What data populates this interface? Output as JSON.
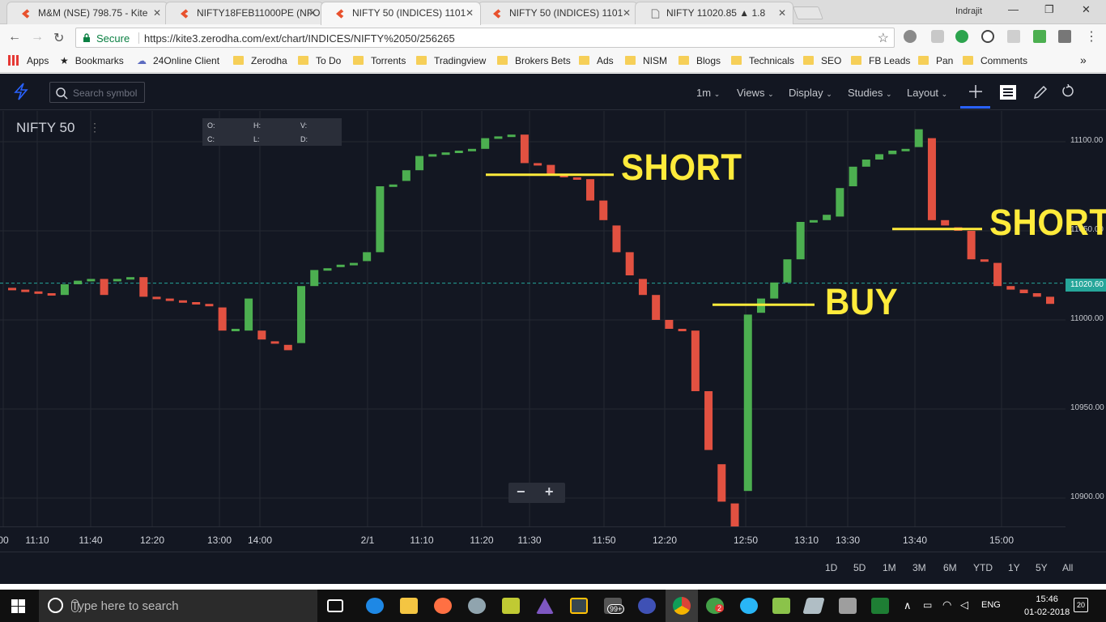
{
  "browser": {
    "tabs": [
      {
        "label": "M&M (NSE) 798.75 - Kite",
        "favicon": "kite-icon",
        "active": false
      },
      {
        "label": "NIFTY18FEB11000PE (NFO",
        "favicon": "kite-icon",
        "active": false
      },
      {
        "label": "NIFTY 50 (INDICES) 1101",
        "favicon": "kite-icon",
        "active": true
      },
      {
        "label": "NIFTY 50 (INDICES) 1101",
        "favicon": "kite-icon",
        "active": false
      },
      {
        "label": "NIFTY   11020.85  ▲ 1.8",
        "favicon": "page-icon",
        "active": false
      }
    ],
    "profile_name": "Indrajit",
    "secure_label": "Secure",
    "url": "https://kite3.zerodha.com/ext/chart/INDICES/NIFTY%2050/256265",
    "bookmarks": [
      {
        "label": "Apps",
        "icon": "apps-grid-icon"
      },
      {
        "label": "Bookmarks",
        "icon": "star-icon"
      },
      {
        "label": "24Online Client",
        "icon": "cloud-icon"
      },
      {
        "label": "Zerodha",
        "icon": "folder-icon"
      },
      {
        "label": "To Do",
        "icon": "folder-icon"
      },
      {
        "label": "Torrents",
        "icon": "folder-icon"
      },
      {
        "label": "Tradingview",
        "icon": "folder-icon"
      },
      {
        "label": "Brokers Bets",
        "icon": "folder-icon"
      },
      {
        "label": "Ads",
        "icon": "folder-icon"
      },
      {
        "label": "NISM",
        "icon": "folder-icon"
      },
      {
        "label": "Blogs",
        "icon": "folder-icon"
      },
      {
        "label": "Technicals",
        "icon": "folder-icon"
      },
      {
        "label": "SEO",
        "icon": "folder-icon"
      },
      {
        "label": "FB Leads",
        "icon": "folder-icon"
      },
      {
        "label": "Pan",
        "icon": "folder-icon"
      },
      {
        "label": "Comments",
        "icon": "folder-icon"
      }
    ],
    "overflow": "»"
  },
  "kite": {
    "search_placeholder": "Search symbol",
    "menus": [
      {
        "label": "1m"
      },
      {
        "label": "Views"
      },
      {
        "label": "Display"
      },
      {
        "label": "Studies"
      },
      {
        "label": "Layout"
      }
    ],
    "symbol": "NIFTY 50",
    "ohlc": {
      "o": "O:",
      "h": "H:",
      "v": "V:",
      "c": "C:",
      "l": "L:",
      "d": "D:"
    },
    "zoom_out": "−",
    "zoom_in": "+",
    "ranges": [
      "1D",
      "5D",
      "1M",
      "3M",
      "6M",
      "YTD",
      "1Y",
      "5Y",
      "All"
    ],
    "annotations": [
      {
        "text": "SHORT",
        "kind": "short"
      },
      {
        "text": "SHORT",
        "kind": "short"
      },
      {
        "text": "BUY",
        "kind": "buy"
      }
    ]
  },
  "chart_data": {
    "type": "candlestick",
    "symbol": "NIFTY 50",
    "interval": "1m",
    "last_price_label": "11020.60",
    "y_ticks": [
      "11100.00",
      "11050.00",
      "11000.00",
      "10950.00",
      "10900.00"
    ],
    "ylim": [
      10880,
      11120
    ],
    "x_ticks": [
      "00",
      "11:10",
      "11:40",
      "12:20",
      "13:00",
      "14:00",
      "2/1",
      "11:10",
      "11:20",
      "11:30",
      "11:50",
      "12:20",
      "12:50",
      "13:10",
      "13:30",
      "13:40",
      "15:00"
    ],
    "colors": {
      "up": "#4caf50",
      "down": "#e25141",
      "background": "#131722",
      "annotation": "#ffeb3b",
      "price_line": "#26a69a"
    },
    "grid": true,
    "candles": [
      {
        "o": 11018,
        "c": 11017
      },
      {
        "o": 11017,
        "c": 11016
      },
      {
        "o": 11016,
        "c": 11015
      },
      {
        "o": 11015,
        "c": 11014
      },
      {
        "o": 11014,
        "c": 11020
      },
      {
        "o": 11020,
        "c": 11022
      },
      {
        "o": 11022,
        "c": 11023
      },
      {
        "o": 11023,
        "c": 11014
      },
      {
        "o": 11022,
        "c": 11023
      },
      {
        "o": 11023,
        "c": 11024
      },
      {
        "o": 11024,
        "c": 11013
      },
      {
        "o": 11013,
        "c": 11012
      },
      {
        "o": 11012,
        "c": 11011
      },
      {
        "o": 11011,
        "c": 11010
      },
      {
        "o": 11010,
        "c": 11009
      },
      {
        "o": 11009,
        "c": 11008
      },
      {
        "o": 11007,
        "c": 10994
      },
      {
        "o": 10994,
        "c": 10995
      },
      {
        "o": 10994,
        "c": 11012
      },
      {
        "o": 10994,
        "c": 10989
      },
      {
        "o": 10988,
        "c": 10987
      },
      {
        "o": 10986,
        "c": 10983
      },
      {
        "o": 10987,
        "c": 11019
      },
      {
        "o": 11019,
        "c": 11028
      },
      {
        "o": 11028,
        "c": 11029
      },
      {
        "o": 11030,
        "c": 11031
      },
      {
        "o": 11031,
        "c": 11032
      },
      {
        "o": 11033,
        "c": 11038
      },
      {
        "o": 11038,
        "c": 11075
      },
      {
        "o": 11075,
        "c": 11076
      },
      {
        "o": 11078,
        "c": 11084
      },
      {
        "o": 11084,
        "c": 11092
      },
      {
        "o": 11092,
        "c": 11093
      },
      {
        "o": 11093,
        "c": 11094
      },
      {
        "o": 11094,
        "c": 11095
      },
      {
        "o": 11095,
        "c": 11096
      },
      {
        "o": 11096,
        "c": 11102
      },
      {
        "o": 11102,
        "c": 11103
      },
      {
        "o": 11103,
        "c": 11104
      },
      {
        "o": 11104,
        "c": 11088
      },
      {
        "o": 11088,
        "c": 11087
      },
      {
        "o": 11087,
        "c": 11082
      },
      {
        "o": 11082,
        "c": 11080
      },
      {
        "o": 11080,
        "c": 11079
      },
      {
        "o": 11079,
        "c": 11067
      },
      {
        "o": 11067,
        "c": 11056
      },
      {
        "o": 11053,
        "c": 11038
      },
      {
        "o": 11038,
        "c": 11025
      },
      {
        "o": 11023,
        "c": 11014
      },
      {
        "o": 11014,
        "c": 11000
      },
      {
        "o": 11000,
        "c": 10995
      },
      {
        "o": 10995,
        "c": 10994
      },
      {
        "o": 10994,
        "c": 10960
      },
      {
        "o": 10960,
        "c": 10927
      },
      {
        "o": 10919,
        "c": 10898
      },
      {
        "o": 10897,
        "c": 10881
      },
      {
        "o": 10904,
        "c": 11003
      },
      {
        "o": 11004,
        "c": 11012
      },
      {
        "o": 11012,
        "c": 11021
      },
      {
        "o": 11021,
        "c": 11034
      },
      {
        "o": 11034,
        "c": 11055
      },
      {
        "o": 11055,
        "c": 11056
      },
      {
        "o": 11056,
        "c": 11059
      },
      {
        "o": 11058,
        "c": 11074
      },
      {
        "o": 11075,
        "c": 11086
      },
      {
        "o": 11086,
        "c": 11090
      },
      {
        "o": 11090,
        "c": 11093
      },
      {
        "o": 11093,
        "c": 11095
      },
      {
        "o": 11095,
        "c": 11096
      },
      {
        "o": 11097,
        "c": 11107
      },
      {
        "o": 11102,
        "c": 11056
      },
      {
        "o": 11056,
        "c": 11053
      },
      {
        "o": 11052,
        "c": 11050
      },
      {
        "o": 11050,
        "c": 11034
      },
      {
        "o": 11034,
        "c": 11033
      },
      {
        "o": 11032,
        "c": 11019
      },
      {
        "o": 11019,
        "c": 11017
      },
      {
        "o": 11017,
        "c": 11015
      },
      {
        "o": 11015,
        "c": 11013
      },
      {
        "o": 11013,
        "c": 11009
      }
    ]
  },
  "taskbar": {
    "search_placeholder": "Type here to search",
    "language": "ENG",
    "time": "15:46",
    "date": "01-02-2018",
    "notifications": "20",
    "badge_mail": "99+",
    "badge_whatsapp": "2"
  }
}
